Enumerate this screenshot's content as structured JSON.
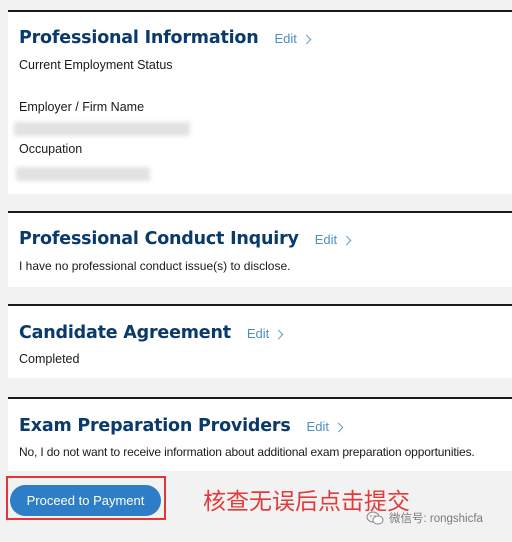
{
  "professional_information": {
    "title": "Professional Information",
    "edit": "Edit",
    "employment_status_label": "Current Employment Status",
    "employer_label": "Employer / Firm Name",
    "occupation_label": "Occupation"
  },
  "professional_conduct": {
    "title": "Professional Conduct Inquiry",
    "edit": "Edit",
    "value": "I have no professional conduct issue(s) to disclose."
  },
  "candidate_agreement": {
    "title": "Candidate Agreement",
    "edit": "Edit",
    "value": "Completed"
  },
  "exam_prep": {
    "title": "Exam Preparation Providers",
    "edit": "Edit",
    "value": "No, I do not want to receive information about additional exam preparation opportunities."
  },
  "footer": {
    "proceed_label": "Proceed to Payment",
    "annotation": "核查无误后点击提交",
    "watermark": "微信号: rongshicfa"
  },
  "colors": {
    "title": "#0a3a6b",
    "link": "#4a8fc4",
    "button": "#2e7dc7",
    "annotation": "#e23a3a"
  }
}
